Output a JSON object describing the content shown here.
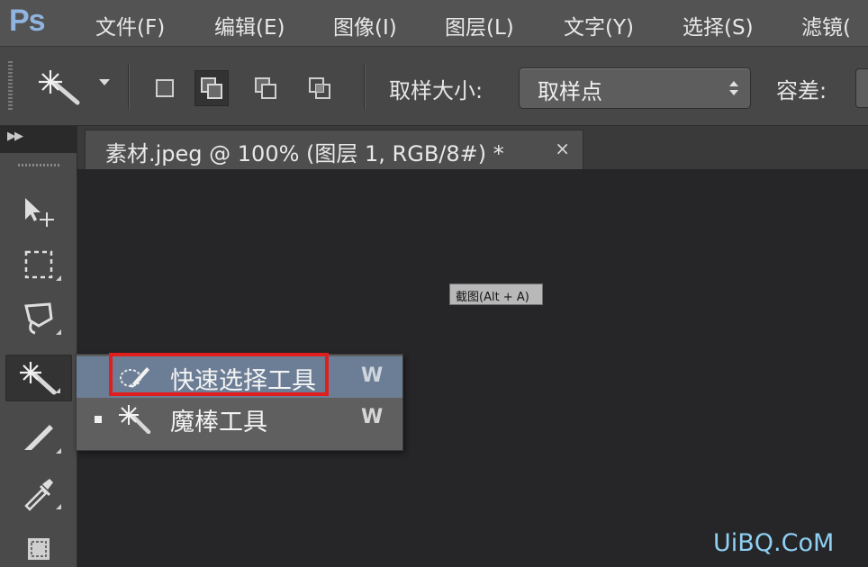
{
  "app": {
    "logo": "Ps"
  },
  "menu": [
    "文件(F)",
    "编辑(E)",
    "图像(I)",
    "图层(L)",
    "文字(Y)",
    "选择(S)",
    "滤镜("
  ],
  "options": {
    "sample_size_label": "取样大小:",
    "sample_size_value": "取样点",
    "tolerance_label": "容差:"
  },
  "document": {
    "tab_title": "素材.jpeg @ 100% (图层 1, RGB/8#) *",
    "close_glyph": "×"
  },
  "tooltip": {
    "text": "截图(Alt + A)"
  },
  "flyout": {
    "items": [
      {
        "label": "快速选择工具",
        "shortcut": "W",
        "icon": "quick-selection-icon",
        "highlighted": true,
        "current": false
      },
      {
        "label": "魔棒工具",
        "shortcut": "W",
        "icon": "magic-wand-icon",
        "highlighted": false,
        "current": true
      }
    ],
    "annotation_color": "#e01e1e"
  },
  "toolbar": {
    "tools": [
      "move-tool",
      "marquee-tool",
      "lasso-tool",
      "magic-wand-tool",
      "crop-tool",
      "eyedropper-tool",
      "patch-tool"
    ]
  },
  "watermark": {
    "text": "UiBQ.CoM"
  },
  "colors": {
    "logo": "#8fb4e0",
    "highlight": "#6c7e95",
    "watermark": "#8fd0f4"
  }
}
